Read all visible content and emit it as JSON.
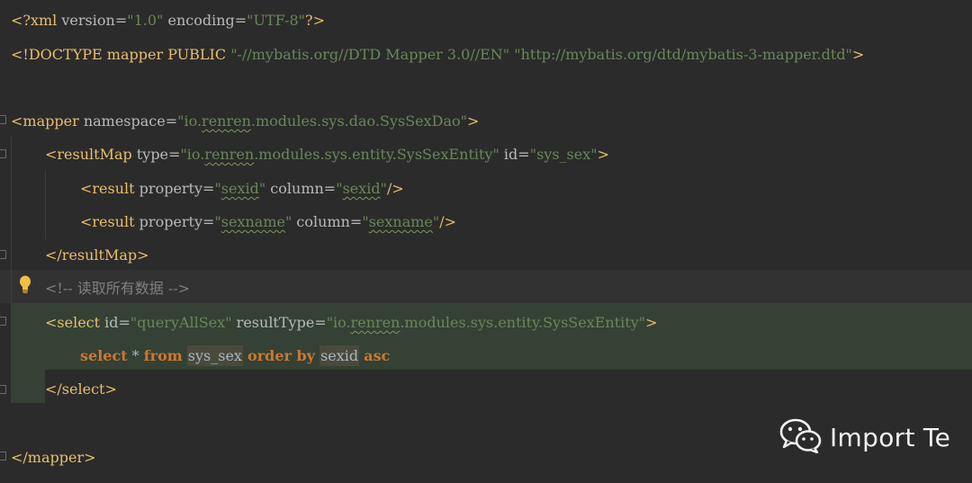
{
  "lines": {
    "l1": {
      "open": "<?xml ",
      "attr1": "version=",
      "val1": "\"1.0\"",
      "attr2": " encoding=",
      "val2": "\"UTF-8\"",
      "close": "?>"
    },
    "l2": {
      "open": "<!DOCTYPE mapper PUBLIC ",
      "val1": "\"-//mybatis.org//DTD Mapper 3.0//EN\"",
      "sp": " ",
      "val2": "\"http://mybatis.org/dtd/mybatis-3-mapper.dtd\"",
      "close": ">"
    },
    "l4": {
      "open": "<mapper ",
      "attr1": "namespace=",
      "q1": "\"io.",
      "sq": "renren",
      "q2": ".modules.sys.dao.SysSexDao\"",
      "close": ">"
    },
    "l5": {
      "open": "<resultMap ",
      "attr1": "type=",
      "q1": "\"io.",
      "sq": "renren",
      "q2": ".modules.sys.entity.SysSexEntity\"",
      "attr2": " id=",
      "val2": "\"sys_sex\"",
      "close": ">"
    },
    "l6": {
      "open": "<result ",
      "attr1": "property=",
      "q1a": "\"",
      "sq1": "sexid",
      "q1b": "\"",
      "attr2": " column=",
      "q2a": "\"",
      "sq2": "sexid",
      "q2b": "\"",
      "close": "/>"
    },
    "l7": {
      "open": "<result ",
      "attr1": "property=",
      "q1a": "\"",
      "sq1": "sexname",
      "q1b": "\"",
      "attr2": " column=",
      "q2a": "\"",
      "sq2": "sexname",
      "q2b": "\"",
      "close": "/>"
    },
    "l8": {
      "close": "</resultMap>"
    },
    "l9": {
      "comment": "<!-- 读取所有数据 -->"
    },
    "l10": {
      "open": "<select ",
      "attr1": "id=",
      "val1": "\"queryAllSex\"",
      "attr2": " resultType=",
      "q1": "\"io.",
      "sq": "renren",
      "q2": ".modules.sys.entity.SysSexEntity\"",
      "close": ">"
    },
    "l11": {
      "kw1": "select",
      "star": " * ",
      "kw2": "from",
      "tbl": "sys_sex",
      "kw3": "order by",
      "col": "sexid",
      "kw4": "asc"
    },
    "l12": {
      "close": "</select>"
    },
    "l14": {
      "close": "</mapper>"
    }
  },
  "watermark": {
    "text": "Import Te",
    "icon": "wechat-icon"
  },
  "gutter": {
    "icon": "lightbulb-icon"
  },
  "colors": {
    "background": "#2b2b2b",
    "tag": "#e8bf6a",
    "string": "#6a8759",
    "keyword": "#cc7832",
    "comment": "#808080",
    "text": "#a9b7c6",
    "highlight": "#344134"
  }
}
